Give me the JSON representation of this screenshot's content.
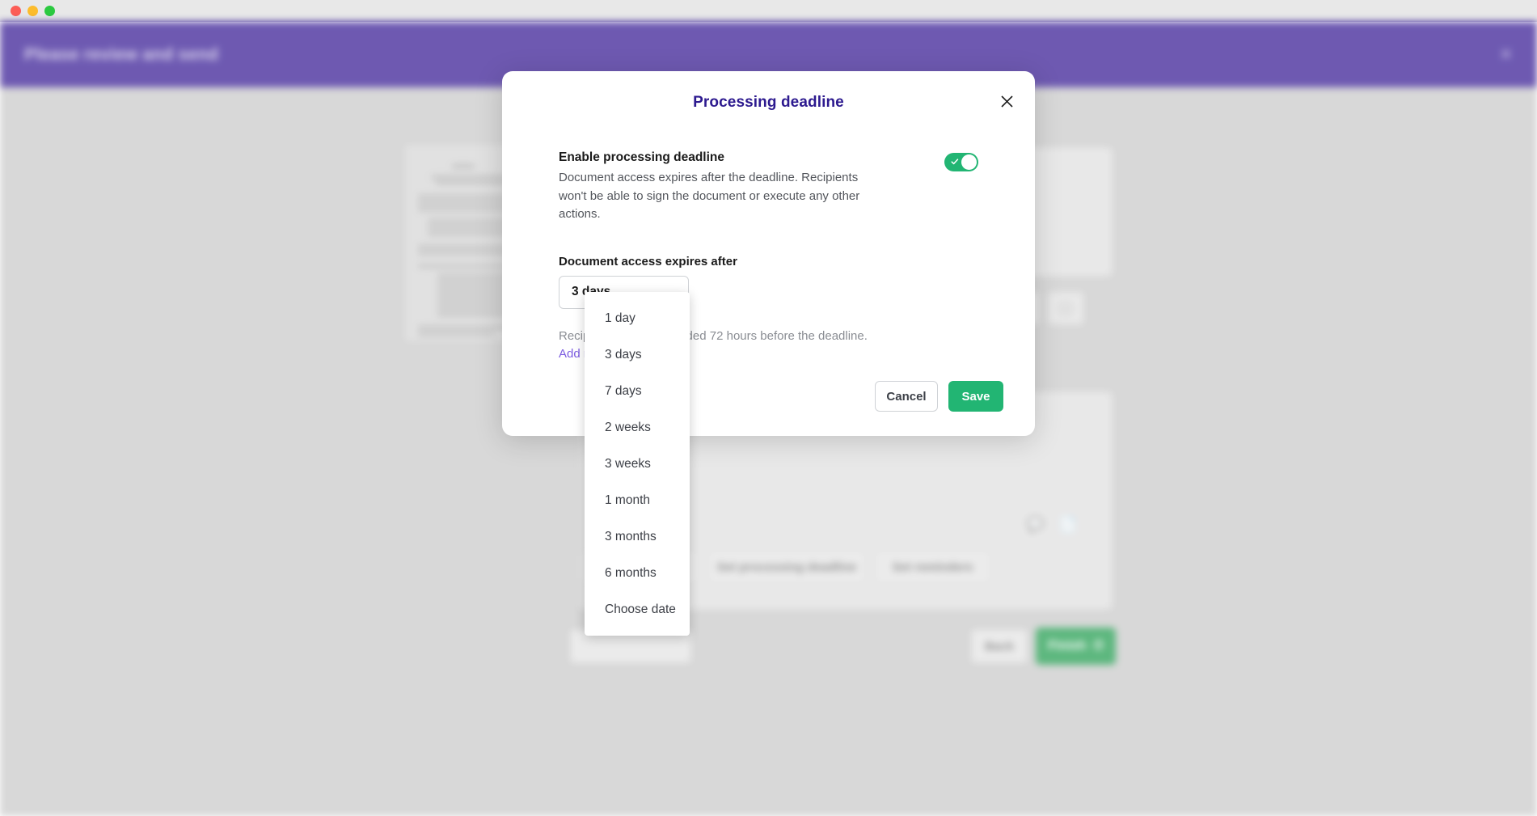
{
  "window": {
    "traffic_lights": [
      "close",
      "minimize",
      "maximize"
    ]
  },
  "background_app": {
    "header_title": "Please review and send",
    "close_icon": "close-icon",
    "buttons": [
      {
        "label": "Set processing deadline"
      },
      {
        "label": "Set reminders"
      }
    ],
    "back_label": "Back",
    "finish_label": "Finish"
  },
  "modal": {
    "title": "Processing deadline",
    "close_icon": "close-icon",
    "enable": {
      "title": "Enable processing deadline",
      "description": "Document access expires after the deadline. Recipients won't be able to sign the document or execute any other actions.",
      "toggle_on": true,
      "toggle_color": "#22b573"
    },
    "field": {
      "label": "Document access expires after",
      "value": "3 days"
    },
    "hint": {
      "text": "Recipients will be reminded 72 hours before the deadline.",
      "link": "Add reminders",
      "link_color": "#7c5ce0"
    },
    "actions": {
      "cancel_label": "Cancel",
      "save_label": "Save"
    }
  },
  "dropdown": {
    "options": [
      {
        "label": "1 day"
      },
      {
        "label": "3 days"
      },
      {
        "label": "7 days"
      },
      {
        "label": "2 weeks"
      },
      {
        "label": "3 weeks"
      },
      {
        "label": "1 month"
      },
      {
        "label": "3 months"
      },
      {
        "label": "6 months"
      },
      {
        "label": "Choose date"
      }
    ]
  },
  "colors": {
    "brand_purple": "#361a94",
    "title_purple": "#2d1a8f",
    "green": "#22b573",
    "link_purple": "#7c5ce0"
  }
}
